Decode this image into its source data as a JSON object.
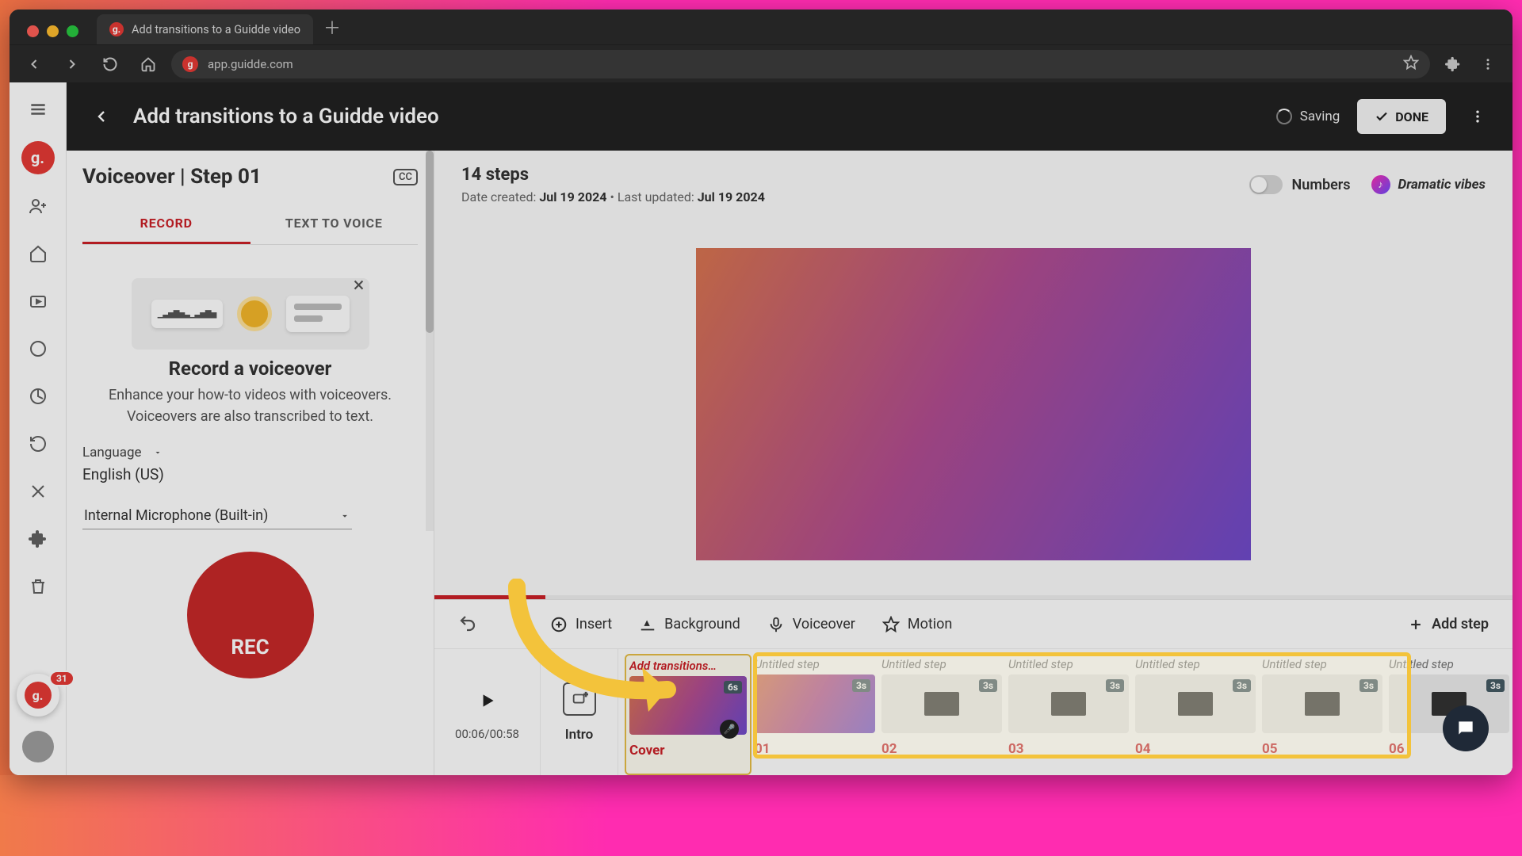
{
  "browser": {
    "tab_title": "Add transitions to a Guidde video",
    "url": "app.guidde.com",
    "favicon_letter": "g."
  },
  "appbar": {
    "title": "Add transitions to a Guidde video",
    "saving": "Saving",
    "done": "DONE"
  },
  "rail": {
    "badge": "31"
  },
  "panel": {
    "title": "Voiceover | Step 01",
    "cc": "CC",
    "tabs": {
      "record": "RECORD",
      "tts": "TEXT TO VOICE"
    },
    "card": {
      "heading": "Record a voiceover",
      "line1": "Enhance your how-to videos with voiceovers.",
      "line2": "Voiceovers are also transcribed to text."
    },
    "language_label": "Language",
    "language_value": "English (US)",
    "mic_value": "Internal Microphone (Built-in)",
    "rec": "REC"
  },
  "meta": {
    "steps": "14 steps",
    "created_label": "Date created: ",
    "created_value": "Jul 19 2024",
    "updated_label": "Last updated: ",
    "updated_value": "Jul 19 2024",
    "numbers": "Numbers",
    "vibes": "Dramatic vibes"
  },
  "tools": {
    "insert": "Insert",
    "background": "Background",
    "voiceover": "Voiceover",
    "motion": "Motion",
    "add_step": "Add step"
  },
  "timeline": {
    "time": "00:06/00:58",
    "intro": "Intro",
    "cover_title": "Add transitions…",
    "cover_label": "Cover",
    "cover_dur": "6s",
    "untitled": "Untitled step",
    "dur3": "3s",
    "nums": [
      "01",
      "02",
      "03",
      "04",
      "05",
      "06"
    ]
  }
}
